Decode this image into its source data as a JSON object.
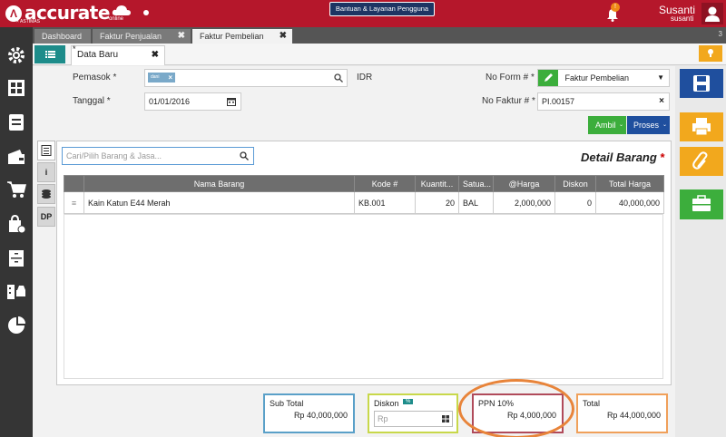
{
  "app": {
    "logo_text": "accurate",
    "logo_sub": "× ASTIMAS",
    "logo_online": "online",
    "help_button": "Bantuan & Layanan Pengguna",
    "notification_count": "!",
    "user_name": "Susanti",
    "user_sub": "susanti"
  },
  "tabs": [
    {
      "label": "Dashboard"
    },
    {
      "label": "Faktur Penjualan",
      "close": "✖"
    },
    {
      "label": "Faktur Pembelian",
      "close": "✖"
    }
  ],
  "tab_count": "3",
  "subtab": {
    "label": "Data Baru",
    "close": "✖",
    "marker": "*"
  },
  "form": {
    "pemasok_label": "Pemasok *",
    "pemasok_chip": "dani",
    "currency": "IDR",
    "tanggal_label": "Tanggal *",
    "tanggal_value": "01/01/2016",
    "no_form_label": "No Form # *",
    "no_form_value": "Faktur Pembelian",
    "no_faktur_label": "No Faktur # *",
    "no_faktur_value": "PI.00157",
    "ambil_button": "Ambil",
    "proses_button": "Proses"
  },
  "detail": {
    "search_placeholder": "Cari/Pilih Barang & Jasa...",
    "title": "Detail Barang",
    "required_mark": "*",
    "side_tab_dp": "DP",
    "side_tab_info": "i",
    "columns": [
      "",
      "Nama Barang",
      "Kode #",
      "Kuantit...",
      "Satua...",
      "@Harga",
      "Diskon",
      "Total Harga"
    ],
    "rows": [
      {
        "handle": "≡",
        "nama": "Kain Katun E44 Merah",
        "kode": "KB.001",
        "kuantitas": "20",
        "satuan": "BAL",
        "harga": "2,000,000",
        "diskon": "0",
        "total": "40,000,000"
      }
    ]
  },
  "summary": {
    "subtotal_label": "Sub Total",
    "subtotal_value": "Rp 40,000,000",
    "diskon_label": "Diskon",
    "diskon_badge": "%",
    "diskon_placeholder": "Rp",
    "ppn_label": "PPN 10%",
    "ppn_value": "Rp 4,000,000",
    "total_label": "Total",
    "total_value": "Rp 44,000,000"
  },
  "colors": {
    "brand_red": "#b5172b",
    "sidebar": "#353535",
    "teal": "#1d8c8a",
    "save_blue": "#1f4f9e",
    "orange": "#f2a81d",
    "green": "#3cae3c",
    "highlight_oval": "#e8843a"
  }
}
